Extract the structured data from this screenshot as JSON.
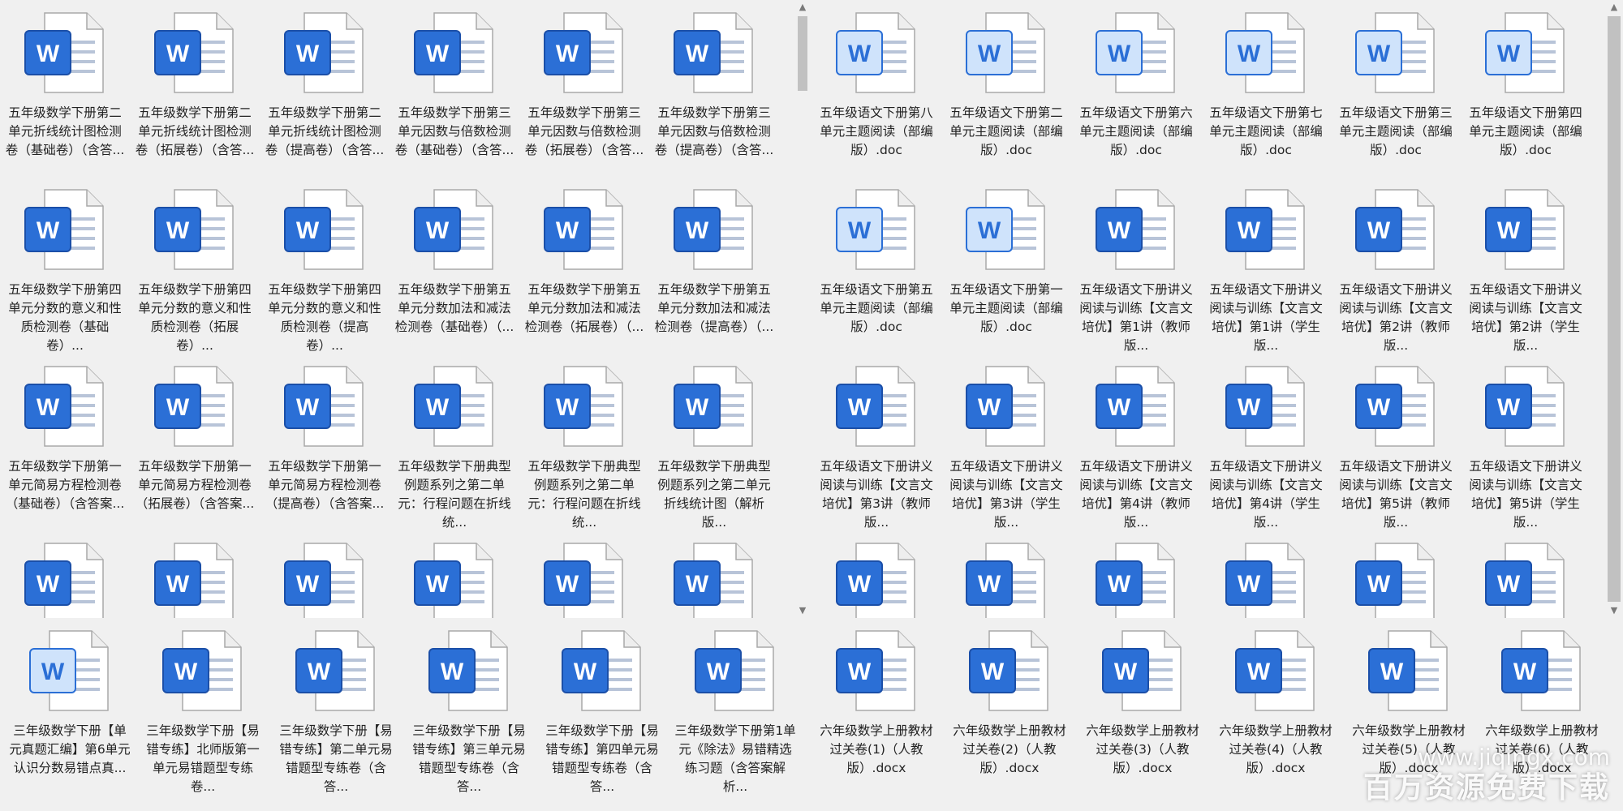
{
  "colors": {
    "word_blue": "#2b6fd6",
    "word_blue_dark": "#1b4fa8",
    "page_line": "#b8c4d8",
    "selected_bg": "#cfe3fb"
  },
  "panel_a": {
    "files": [
      {
        "name": "五年级数学下册第二单元折线统计图检测卷（基础卷）（含答...",
        "icon": "word-doc-icon"
      },
      {
        "name": "五年级数学下册第二单元折线统计图检测卷（拓展卷）（含答...",
        "icon": "word-doc-icon"
      },
      {
        "name": "五年级数学下册第二单元折线统计图检测卷（提高卷）（含答...",
        "icon": "word-doc-icon"
      },
      {
        "name": "五年级数学下册第三单元因数与倍数检测卷（基础卷）（含答...",
        "icon": "word-doc-icon"
      },
      {
        "name": "五年级数学下册第三单元因数与倍数检测卷（拓展卷）（含答...",
        "icon": "word-doc-icon"
      },
      {
        "name": "五年级数学下册第三单元因数与倍数检测卷（提高卷）（含答...",
        "icon": "word-doc-icon"
      },
      {
        "name": "五年级数学下册第四单元分数的意义和性质检测卷（基础卷）...",
        "icon": "word-doc-icon"
      },
      {
        "name": "五年级数学下册第四单元分数的意义和性质检测卷（拓展卷）...",
        "icon": "word-doc-icon"
      },
      {
        "name": "五年级数学下册第四单元分数的意义和性质检测卷（提高卷）...",
        "icon": "word-doc-icon"
      },
      {
        "name": "五年级数学下册第五单元分数加法和减法检测卷（基础卷）（...",
        "icon": "word-doc-icon"
      },
      {
        "name": "五年级数学下册第五单元分数加法和减法检测卷（拓展卷）（...",
        "icon": "word-doc-icon"
      },
      {
        "name": "五年级数学下册第五单元分数加法和减法检测卷（提高卷）（...",
        "icon": "word-doc-icon"
      },
      {
        "name": "五年级数学下册第一单元简易方程检测卷（基础卷）（含答案...",
        "icon": "word-doc-icon"
      },
      {
        "name": "五年级数学下册第一单元简易方程检测卷（拓展卷）（含答案...",
        "icon": "word-doc-icon"
      },
      {
        "name": "五年级数学下册第一单元简易方程检测卷（提高卷）（含答案...",
        "icon": "word-doc-icon"
      },
      {
        "name": "五年级数学下册典型例题系列之第二单元：行程问题在折线统...",
        "icon": "word-doc-icon"
      },
      {
        "name": "五年级数学下册典型例题系列之第二单元：行程问题在折线统...",
        "icon": "word-doc-icon"
      },
      {
        "name": "五年级数学下册典型例题系列之第二单元折线统计图（解析版...",
        "icon": "word-doc-icon"
      },
      {
        "name": "",
        "icon": "word-doc-icon"
      },
      {
        "name": "",
        "icon": "word-doc-icon"
      },
      {
        "name": "",
        "icon": "word-doc-icon"
      },
      {
        "name": "",
        "icon": "word-doc-icon"
      },
      {
        "name": "",
        "icon": "word-doc-icon"
      },
      {
        "name": "",
        "icon": "word-doc-icon"
      }
    ]
  },
  "panel_b": {
    "files": [
      {
        "name": "五年级语文下册第八单元主题阅读（部编版）.doc",
        "icon": "word-legacy-icon"
      },
      {
        "name": "五年级语文下册第二单元主题阅读（部编版）.doc",
        "icon": "word-legacy-icon"
      },
      {
        "name": "五年级语文下册第六单元主题阅读（部编版）.doc",
        "icon": "word-legacy-icon"
      },
      {
        "name": "五年级语文下册第七单元主题阅读（部编版）.doc",
        "icon": "word-legacy-icon"
      },
      {
        "name": "五年级语文下册第三单元主题阅读（部编版）.doc",
        "icon": "word-legacy-icon"
      },
      {
        "name": "五年级语文下册第四单元主题阅读（部编版）.doc",
        "icon": "word-legacy-icon"
      },
      {
        "name": "五年级语文下册第五单元主题阅读（部编版）.doc",
        "icon": "word-legacy-icon"
      },
      {
        "name": "五年级语文下册第一单元主题阅读（部编版）.doc",
        "icon": "word-legacy-icon"
      },
      {
        "name": "五年级语文下册讲义阅读与训练【文言文培优】第1讲（教师版...",
        "icon": "word-doc-icon"
      },
      {
        "name": "五年级语文下册讲义阅读与训练【文言文培优】第1讲（学生版...",
        "icon": "word-doc-icon"
      },
      {
        "name": "五年级语文下册讲义阅读与训练【文言文培优】第2讲（教师版...",
        "icon": "word-doc-icon"
      },
      {
        "name": "五年级语文下册讲义阅读与训练【文言文培优】第2讲（学生版...",
        "icon": "word-doc-icon"
      },
      {
        "name": "五年级语文下册讲义阅读与训练【文言文培优】第3讲（教师版...",
        "icon": "word-doc-icon"
      },
      {
        "name": "五年级语文下册讲义阅读与训练【文言文培优】第3讲（学生版...",
        "icon": "word-doc-icon"
      },
      {
        "name": "五年级语文下册讲义阅读与训练【文言文培优】第4讲（教师版...",
        "icon": "word-doc-icon"
      },
      {
        "name": "五年级语文下册讲义阅读与训练【文言文培优】第4讲（学生版...",
        "icon": "word-doc-icon"
      },
      {
        "name": "五年级语文下册讲义阅读与训练【文言文培优】第5讲（教师版...",
        "icon": "word-doc-icon"
      },
      {
        "name": "五年级语文下册讲义阅读与训练【文言文培优】第5讲（学生版...",
        "icon": "word-doc-icon"
      },
      {
        "name": "",
        "icon": "word-doc-icon"
      },
      {
        "name": "",
        "icon": "word-doc-icon"
      },
      {
        "name": "",
        "icon": "word-doc-icon"
      },
      {
        "name": "",
        "icon": "word-doc-icon"
      },
      {
        "name": "",
        "icon": "word-doc-icon"
      },
      {
        "name": "",
        "icon": "word-doc-icon"
      }
    ]
  },
  "panel_c": {
    "files": [
      {
        "name": "三年级数学下册【单元真题汇编】第6单元认识分数易错点真...",
        "icon": "word-legacy-icon"
      },
      {
        "name": "三年级数学下册【易错专练】北师版第一单元易错题型专练卷...",
        "icon": "word-doc-icon"
      },
      {
        "name": "三年级数学下册【易错专练】第二单元易错题型专练卷（含答...",
        "icon": "word-doc-icon"
      },
      {
        "name": "三年级数学下册【易错专练】第三单元易错题型专练卷（含答...",
        "icon": "word-doc-icon"
      },
      {
        "name": "三年级数学下册【易错专练】第四单元易错题型专练卷（含答...",
        "icon": "word-doc-icon"
      },
      {
        "name": "三年级数学下册第1单元《除法》易错精选练习题（含答案解析...",
        "icon": "word-doc-icon"
      }
    ]
  },
  "panel_d": {
    "files": [
      {
        "name": "六年级数学上册教材过关卷(1)（人教版）.docx",
        "icon": "word-doc-icon"
      },
      {
        "name": "六年级数学上册教材过关卷(2)（人教版）.docx",
        "icon": "word-doc-icon"
      },
      {
        "name": "六年级数学上册教材过关卷(3)（人教版）.docx",
        "icon": "word-doc-icon"
      },
      {
        "name": "六年级数学上册教材过关卷(4)（人教版）.docx",
        "icon": "word-doc-icon"
      },
      {
        "name": "六年级数学上册教材过关卷(5)（人教版）.docx",
        "icon": "word-doc-icon"
      },
      {
        "name": "六年级数学上册教材过关卷(6)（人教版）.docx",
        "icon": "word-doc-icon"
      }
    ]
  },
  "watermark": {
    "url": "www.jiqingx.com",
    "text": "百万资源免费下载"
  }
}
